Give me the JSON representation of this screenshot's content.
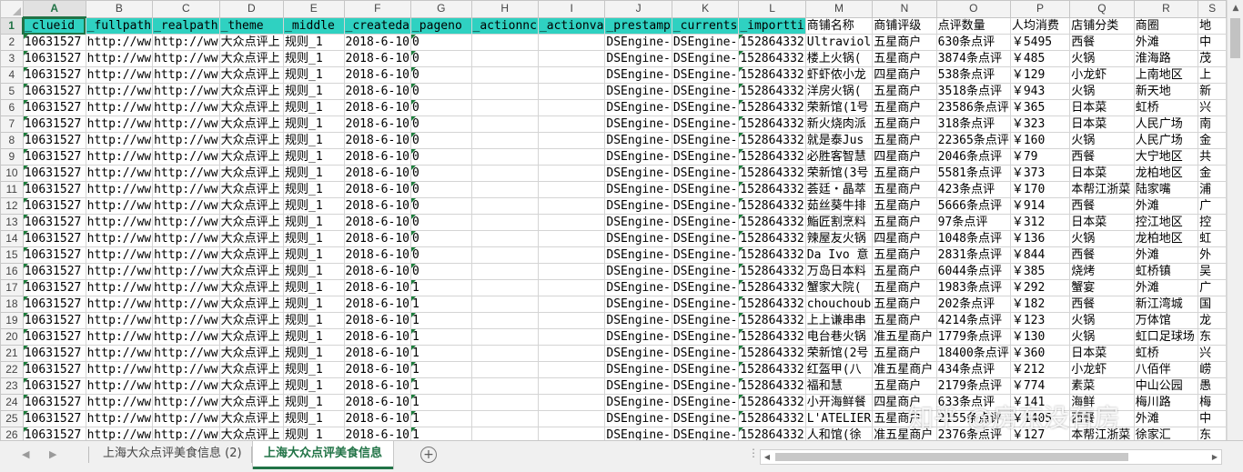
{
  "columns": [
    "A",
    "B",
    "C",
    "D",
    "E",
    "F",
    "G",
    "H",
    "I",
    "J",
    "K",
    "L",
    "M",
    "N",
    "O",
    "P",
    "Q",
    "R",
    "S"
  ],
  "selected_column": "A",
  "header_row": {
    "row_number": "1",
    "cells": [
      "_clueid",
      "_fullpath",
      "_realpath",
      "_theme",
      "_middle",
      "_createda",
      "_pageno",
      "_actionnc",
      "_actionva",
      "_prestamp",
      "_currents",
      "_importti",
      "商铺名称",
      "商铺评级",
      "点评数量",
      "人均消费",
      "店铺分类",
      "商圈",
      "地"
    ]
  },
  "rows": [
    {
      "n": "2",
      "c": [
        "10631527",
        "http://ww",
        "http://ww",
        "大众点评上",
        "规则_1",
        "2018-6-10",
        "0",
        "",
        "",
        "DSEngine-",
        "DSEngine-",
        "152864332",
        "Ultraviol",
        "五星商户",
        "630条点评",
        "￥5495",
        "西餐",
        "外滩",
        "中"
      ]
    },
    {
      "n": "3",
      "c": [
        "10631527",
        "http://ww",
        "http://ww",
        "大众点评上",
        "规则_1",
        "2018-6-10",
        "0",
        "",
        "",
        "DSEngine-",
        "DSEngine-",
        "152864332",
        "楼上火锅(",
        "五星商户",
        "3874条点评",
        "￥485",
        "火锅",
        "淮海路",
        "茂"
      ]
    },
    {
      "n": "4",
      "c": [
        "10631527",
        "http://ww",
        "http://ww",
        "大众点评上",
        "规则_1",
        "2018-6-10",
        "0",
        "",
        "",
        "DSEngine-",
        "DSEngine-",
        "152864332",
        "虾虾侬小龙",
        "四星商户",
        "538条点评",
        "￥129",
        "小龙虾",
        "上南地区",
        "上"
      ]
    },
    {
      "n": "5",
      "c": [
        "10631527",
        "http://ww",
        "http://ww",
        "大众点评上",
        "规则_1",
        "2018-6-10",
        "0",
        "",
        "",
        "DSEngine-",
        "DSEngine-",
        "152864332",
        "洋房火锅(",
        "五星商户",
        "3518条点评",
        "￥943",
        "火锅",
        "新天地",
        "新"
      ]
    },
    {
      "n": "6",
      "c": [
        "10631527",
        "http://ww",
        "http://ww",
        "大众点评上",
        "规则_1",
        "2018-6-10",
        "0",
        "",
        "",
        "DSEngine-",
        "DSEngine-",
        "152864332",
        "荣新馆(1号",
        "五星商户",
        "23586条点评",
        "￥365",
        "日本菜",
        "虹桥",
        "兴"
      ]
    },
    {
      "n": "7",
      "c": [
        "10631527",
        "http://ww",
        "http://ww",
        "大众点评上",
        "规则_1",
        "2018-6-10",
        "0",
        "",
        "",
        "DSEngine-",
        "DSEngine-",
        "152864332",
        "新火烧肉派",
        "五星商户",
        "318条点评",
        "￥323",
        "日本菜",
        "人民广场",
        "南"
      ]
    },
    {
      "n": "8",
      "c": [
        "10631527",
        "http://ww",
        "http://ww",
        "大众点评上",
        "规则_1",
        "2018-6-10",
        "0",
        "",
        "",
        "DSEngine-",
        "DSEngine-",
        "152864332",
        "就是泰Jus",
        "五星商户",
        "22365条点评",
        "￥160",
        "火锅",
        "人民广场",
        "金"
      ]
    },
    {
      "n": "9",
      "c": [
        "10631527",
        "http://ww",
        "http://ww",
        "大众点评上",
        "规则_1",
        "2018-6-10",
        "0",
        "",
        "",
        "DSEngine-",
        "DSEngine-",
        "152864332",
        "必胜客智慧",
        "四星商户",
        "2046条点评",
        "￥79",
        "西餐",
        "大宁地区",
        "共"
      ]
    },
    {
      "n": "10",
      "c": [
        "10631527",
        "http://ww",
        "http://ww",
        "大众点评上",
        "规则_1",
        "2018-6-10",
        "0",
        "",
        "",
        "DSEngine-",
        "DSEngine-",
        "152864332",
        "荣新馆(3号",
        "五星商户",
        "5581条点评",
        "￥373",
        "日本菜",
        "龙柏地区",
        "金"
      ]
    },
    {
      "n": "11",
      "c": [
        "10631527",
        "http://ww",
        "http://ww",
        "大众点评上",
        "规则_1",
        "2018-6-10",
        "0",
        "",
        "",
        "DSEngine-",
        "DSEngine-",
        "152864332",
        "荟廷・晶萃",
        "五星商户",
        "423条点评",
        "￥170",
        "本帮江浙菜",
        "陆家嘴",
        "浦"
      ]
    },
    {
      "n": "12",
      "c": [
        "10631527",
        "http://ww",
        "http://ww",
        "大众点评上",
        "规则_1",
        "2018-6-10",
        "0",
        "",
        "",
        "DSEngine-",
        "DSEngine-",
        "152864332",
        "茹丝葵牛排",
        "五星商户",
        "5666条点评",
        "￥914",
        "西餐",
        "外滩",
        "广"
      ]
    },
    {
      "n": "13",
      "c": [
        "10631527",
        "http://ww",
        "http://ww",
        "大众点评上",
        "规则_1",
        "2018-6-10",
        "0",
        "",
        "",
        "DSEngine-",
        "DSEngine-",
        "152864332",
        "鮨匠割烹料",
        "五星商户",
        "97条点评",
        "￥312",
        "日本菜",
        "控江地区",
        "控"
      ]
    },
    {
      "n": "14",
      "c": [
        "10631527",
        "http://ww",
        "http://ww",
        "大众点评上",
        "规则_1",
        "2018-6-10",
        "0",
        "",
        "",
        "DSEngine-",
        "DSEngine-",
        "152864332",
        "辣屋友火锅",
        "四星商户",
        "1048条点评",
        "￥136",
        "火锅",
        "龙柏地区",
        "虹"
      ]
    },
    {
      "n": "15",
      "c": [
        "10631527",
        "http://ww",
        "http://ww",
        "大众点评上",
        "规则_1",
        "2018-6-10",
        "0",
        "",
        "",
        "DSEngine-",
        "DSEngine-",
        "152864332",
        "Da Ivo 意",
        "五星商户",
        "2831条点评",
        "￥844",
        "西餐",
        "外滩",
        "外"
      ]
    },
    {
      "n": "16",
      "c": [
        "10631527",
        "http://ww",
        "http://ww",
        "大众点评上",
        "规则_1",
        "2018-6-10",
        "0",
        "",
        "",
        "DSEngine-",
        "DSEngine-",
        "152864332",
        "万岛日本料",
        "五星商户",
        "6044条点评",
        "￥385",
        "烧烤",
        "虹桥镇",
        "吴"
      ]
    },
    {
      "n": "17",
      "c": [
        "10631527",
        "http://ww",
        "http://ww",
        "大众点评上",
        "规则_1",
        "2018-6-10",
        "1",
        "",
        "",
        "DSEngine-",
        "DSEngine-",
        "152864332",
        "蟹家大院(",
        "五星商户",
        "1983条点评",
        "￥292",
        "蟹宴",
        "外滩",
        "广"
      ]
    },
    {
      "n": "18",
      "c": [
        "10631527",
        "http://ww",
        "http://ww",
        "大众点评上",
        "规则_1",
        "2018-6-10",
        "1",
        "",
        "",
        "DSEngine-",
        "DSEngine-",
        "152864332",
        "chouchoub",
        "五星商户",
        "202条点评",
        "￥182",
        "西餐",
        "新江湾城",
        "国"
      ]
    },
    {
      "n": "19",
      "c": [
        "10631527",
        "http://ww",
        "http://ww",
        "大众点评上",
        "规则_1",
        "2018-6-10",
        "1",
        "",
        "",
        "DSEngine-",
        "DSEngine-",
        "152864332",
        "上上谦串串",
        "五星商户",
        "4214条点评",
        "￥123",
        "火锅",
        "万体馆",
        "龙"
      ]
    },
    {
      "n": "20",
      "c": [
        "10631527",
        "http://ww",
        "http://ww",
        "大众点评上",
        "规则_1",
        "2018-6-10",
        "1",
        "",
        "",
        "DSEngine-",
        "DSEngine-",
        "152864332",
        "电台巷火锅",
        "准五星商户",
        "1779条点评",
        "￥130",
        "火锅",
        "虹口足球场",
        "东"
      ]
    },
    {
      "n": "21",
      "c": [
        "10631527",
        "http://ww",
        "http://ww",
        "大众点评上",
        "规则_1",
        "2018-6-10",
        "1",
        "",
        "",
        "DSEngine-",
        "DSEngine-",
        "152864332",
        "荣新馆(2号",
        "五星商户",
        "18400条点评",
        "￥360",
        "日本菜",
        "虹桥",
        "兴"
      ]
    },
    {
      "n": "22",
      "c": [
        "10631527",
        "http://ww",
        "http://ww",
        "大众点评上",
        "规则_1",
        "2018-6-10",
        "1",
        "",
        "",
        "DSEngine-",
        "DSEngine-",
        "152864332",
        "红盔甲(八",
        "准五星商户",
        "434条点评",
        "￥212",
        "小龙虾",
        "八佰伴",
        "崂"
      ]
    },
    {
      "n": "23",
      "c": [
        "10631527",
        "http://ww",
        "http://ww",
        "大众点评上",
        "规则_1",
        "2018-6-10",
        "1",
        "",
        "",
        "DSEngine-",
        "DSEngine-",
        "152864332",
        "福和慧",
        "五星商户",
        "2179条点评",
        "￥774",
        "素菜",
        "中山公园",
        "愚"
      ]
    },
    {
      "n": "24",
      "c": [
        "10631527",
        "http://ww",
        "http://ww",
        "大众点评上",
        "规则_1",
        "2018-6-10",
        "1",
        "",
        "",
        "DSEngine-",
        "DSEngine-",
        "152864332",
        "小开海鲜餐",
        "四星商户",
        "633条点评",
        "￥141",
        "海鲜",
        "梅川路",
        "梅"
      ]
    },
    {
      "n": "25",
      "c": [
        "10631527",
        "http://ww",
        "http://ww",
        "大众点评上",
        "规则_1",
        "2018-6-10",
        "1",
        "",
        "",
        "DSEngine-",
        "DSEngine-",
        "152864332",
        "L'ATELIER",
        "五星商户",
        "2155条点评",
        "￥1405",
        "西餐",
        "外滩",
        "中"
      ]
    },
    {
      "n": "26",
      "c": [
        "10631527",
        "http://ww",
        "http://ww",
        "大众点评上",
        "规则_1",
        "2018-6-10",
        "1",
        "",
        "",
        "DSEngine-",
        "DSEngine-",
        "152864332",
        "人和馆(徐",
        "准五星商户",
        "2376条点评",
        "￥127",
        "本帮江浙菜",
        "徐家汇",
        "东"
      ]
    }
  ],
  "sheet_tabs": [
    {
      "label": "上海大众点评美食信息 (2)",
      "active": false
    },
    {
      "label": "上海大众点评美食信息",
      "active": true
    }
  ],
  "watermark": "知乎 @房东没有房",
  "icons": {
    "nav_prev": "caret-left-icon",
    "nav_next": "caret-right-icon",
    "add_sheet": "plus-circle-icon",
    "scroll_up": "caret-up-icon",
    "scroll_left": "caret-left-icon",
    "scroll_right": "caret-right-icon"
  }
}
